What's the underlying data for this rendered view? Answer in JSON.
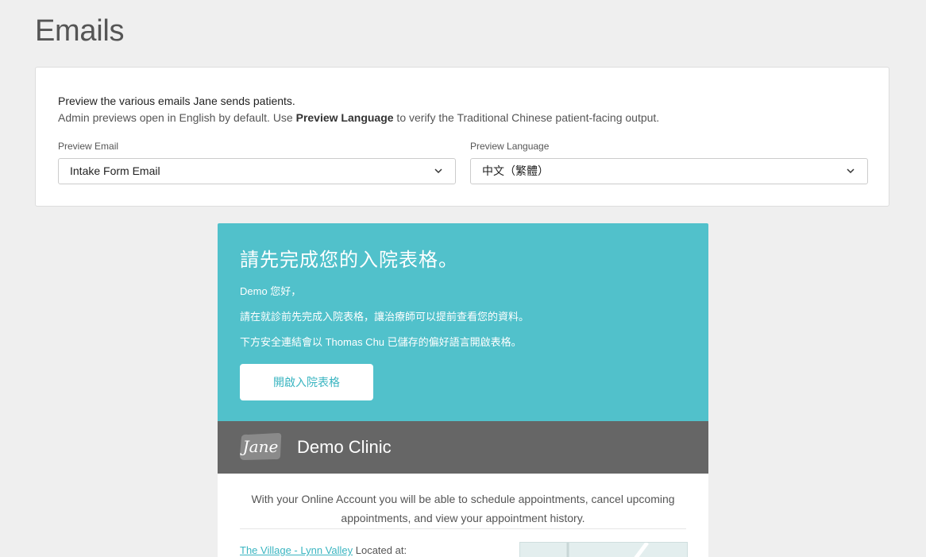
{
  "page": {
    "title": "Emails"
  },
  "settings": {
    "intro_line1": "Preview the various emails Jane sends patients.",
    "intro_line2_before": "Admin previews open in English by default. Use ",
    "intro_line2_bold": "Preview Language",
    "intro_line2_after": " to verify the Traditional Chinese patient-facing output.",
    "preview_email": {
      "label": "Preview Email",
      "value": "Intake Form Email"
    },
    "preview_language": {
      "label": "Preview Language",
      "value": "中文（繁體）"
    }
  },
  "email": {
    "heading": "請先完成您的入院表格。",
    "greeting": "Demo 您好，",
    "p1": "請在就診前先完成入院表格，讓治療師可以提前查看您的資料。",
    "p2": "下方安全連結會以 Thomas Chu 已儲存的偏好語言開啟表格。",
    "button": "開啟入院表格",
    "logo_text": "Jane",
    "clinic_name": "Demo Clinic",
    "body_text": "With your Online Account you will be able to schedule appointments, cancel upcoming appointments, and view your appointment history.",
    "location_link": "The Village - Lynn Valley",
    "location_suffix": " Located at:"
  },
  "colors": {
    "hero": "#51c1cb",
    "brand_bar": "#666666",
    "accent": "#3ab5c1"
  },
  "icons": {
    "dropdown": "chevron-down-icon"
  }
}
